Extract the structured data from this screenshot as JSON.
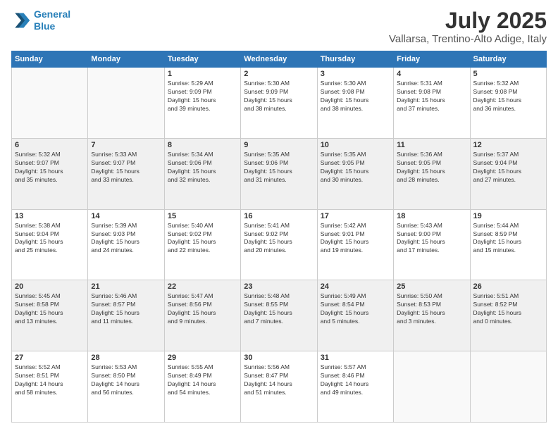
{
  "header": {
    "logo_line1": "General",
    "logo_line2": "Blue",
    "month_year": "July 2025",
    "location": "Vallarsa, Trentino-Alto Adige, Italy"
  },
  "days_of_week": [
    "Sunday",
    "Monday",
    "Tuesday",
    "Wednesday",
    "Thursday",
    "Friday",
    "Saturday"
  ],
  "weeks": [
    [
      {
        "day": "",
        "info": ""
      },
      {
        "day": "",
        "info": ""
      },
      {
        "day": "1",
        "info": "Sunrise: 5:29 AM\nSunset: 9:09 PM\nDaylight: 15 hours\nand 39 minutes."
      },
      {
        "day": "2",
        "info": "Sunrise: 5:30 AM\nSunset: 9:09 PM\nDaylight: 15 hours\nand 38 minutes."
      },
      {
        "day": "3",
        "info": "Sunrise: 5:30 AM\nSunset: 9:08 PM\nDaylight: 15 hours\nand 38 minutes."
      },
      {
        "day": "4",
        "info": "Sunrise: 5:31 AM\nSunset: 9:08 PM\nDaylight: 15 hours\nand 37 minutes."
      },
      {
        "day": "5",
        "info": "Sunrise: 5:32 AM\nSunset: 9:08 PM\nDaylight: 15 hours\nand 36 minutes."
      }
    ],
    [
      {
        "day": "6",
        "info": "Sunrise: 5:32 AM\nSunset: 9:07 PM\nDaylight: 15 hours\nand 35 minutes."
      },
      {
        "day": "7",
        "info": "Sunrise: 5:33 AM\nSunset: 9:07 PM\nDaylight: 15 hours\nand 33 minutes."
      },
      {
        "day": "8",
        "info": "Sunrise: 5:34 AM\nSunset: 9:06 PM\nDaylight: 15 hours\nand 32 minutes."
      },
      {
        "day": "9",
        "info": "Sunrise: 5:35 AM\nSunset: 9:06 PM\nDaylight: 15 hours\nand 31 minutes."
      },
      {
        "day": "10",
        "info": "Sunrise: 5:35 AM\nSunset: 9:05 PM\nDaylight: 15 hours\nand 30 minutes."
      },
      {
        "day": "11",
        "info": "Sunrise: 5:36 AM\nSunset: 9:05 PM\nDaylight: 15 hours\nand 28 minutes."
      },
      {
        "day": "12",
        "info": "Sunrise: 5:37 AM\nSunset: 9:04 PM\nDaylight: 15 hours\nand 27 minutes."
      }
    ],
    [
      {
        "day": "13",
        "info": "Sunrise: 5:38 AM\nSunset: 9:04 PM\nDaylight: 15 hours\nand 25 minutes."
      },
      {
        "day": "14",
        "info": "Sunrise: 5:39 AM\nSunset: 9:03 PM\nDaylight: 15 hours\nand 24 minutes."
      },
      {
        "day": "15",
        "info": "Sunrise: 5:40 AM\nSunset: 9:02 PM\nDaylight: 15 hours\nand 22 minutes."
      },
      {
        "day": "16",
        "info": "Sunrise: 5:41 AM\nSunset: 9:02 PM\nDaylight: 15 hours\nand 20 minutes."
      },
      {
        "day": "17",
        "info": "Sunrise: 5:42 AM\nSunset: 9:01 PM\nDaylight: 15 hours\nand 19 minutes."
      },
      {
        "day": "18",
        "info": "Sunrise: 5:43 AM\nSunset: 9:00 PM\nDaylight: 15 hours\nand 17 minutes."
      },
      {
        "day": "19",
        "info": "Sunrise: 5:44 AM\nSunset: 8:59 PM\nDaylight: 15 hours\nand 15 minutes."
      }
    ],
    [
      {
        "day": "20",
        "info": "Sunrise: 5:45 AM\nSunset: 8:58 PM\nDaylight: 15 hours\nand 13 minutes."
      },
      {
        "day": "21",
        "info": "Sunrise: 5:46 AM\nSunset: 8:57 PM\nDaylight: 15 hours\nand 11 minutes."
      },
      {
        "day": "22",
        "info": "Sunrise: 5:47 AM\nSunset: 8:56 PM\nDaylight: 15 hours\nand 9 minutes."
      },
      {
        "day": "23",
        "info": "Sunrise: 5:48 AM\nSunset: 8:55 PM\nDaylight: 15 hours\nand 7 minutes."
      },
      {
        "day": "24",
        "info": "Sunrise: 5:49 AM\nSunset: 8:54 PM\nDaylight: 15 hours\nand 5 minutes."
      },
      {
        "day": "25",
        "info": "Sunrise: 5:50 AM\nSunset: 8:53 PM\nDaylight: 15 hours\nand 3 minutes."
      },
      {
        "day": "26",
        "info": "Sunrise: 5:51 AM\nSunset: 8:52 PM\nDaylight: 15 hours\nand 0 minutes."
      }
    ],
    [
      {
        "day": "27",
        "info": "Sunrise: 5:52 AM\nSunset: 8:51 PM\nDaylight: 14 hours\nand 58 minutes."
      },
      {
        "day": "28",
        "info": "Sunrise: 5:53 AM\nSunset: 8:50 PM\nDaylight: 14 hours\nand 56 minutes."
      },
      {
        "day": "29",
        "info": "Sunrise: 5:55 AM\nSunset: 8:49 PM\nDaylight: 14 hours\nand 54 minutes."
      },
      {
        "day": "30",
        "info": "Sunrise: 5:56 AM\nSunset: 8:47 PM\nDaylight: 14 hours\nand 51 minutes."
      },
      {
        "day": "31",
        "info": "Sunrise: 5:57 AM\nSunset: 8:46 PM\nDaylight: 14 hours\nand 49 minutes."
      },
      {
        "day": "",
        "info": ""
      },
      {
        "day": "",
        "info": ""
      }
    ]
  ]
}
